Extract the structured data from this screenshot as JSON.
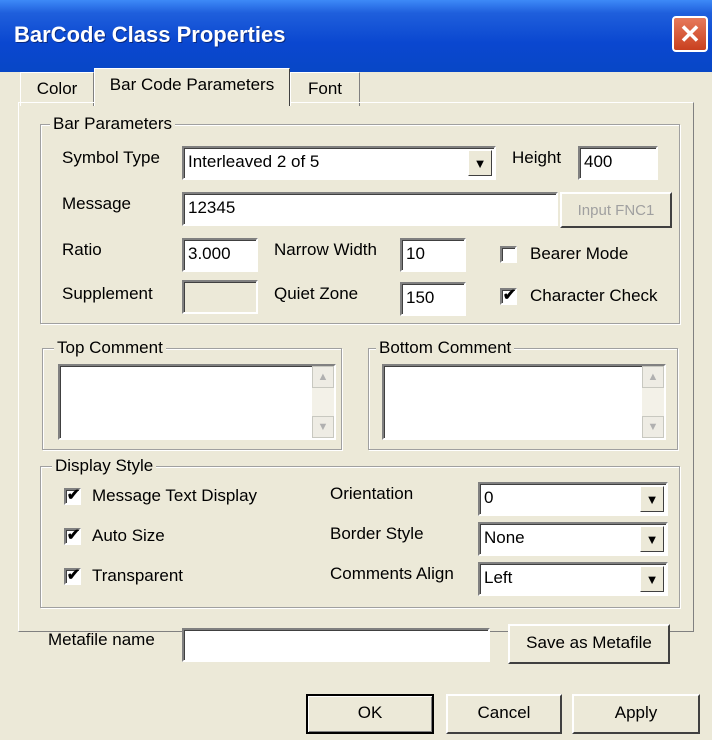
{
  "window": {
    "title": "BarCode Class Properties"
  },
  "tabs": [
    "Color",
    "Bar Code Parameters",
    "Font"
  ],
  "bar_parameters": {
    "legend": "Bar Parameters",
    "symbol_type_label": "Symbol Type",
    "symbol_type_value": "Interleaved 2 of 5",
    "height_label": "Height",
    "height_value": "400",
    "message_label": "Message",
    "message_value": "12345",
    "input_fnc1_label": "Input FNC1",
    "ratio_label": "Ratio",
    "ratio_value": "3.000",
    "narrow_width_label": "Narrow Width",
    "narrow_width_value": "10",
    "bearer_mode_label": "Bearer  Mode",
    "bearer_mode_checked": false,
    "supplement_label": "Supplement",
    "supplement_value": "",
    "quiet_zone_label": "Quiet Zone",
    "quiet_zone_value": "150",
    "character_check_label": "Character Check",
    "character_check_checked": true
  },
  "top_comment": {
    "legend": "Top Comment",
    "value": ""
  },
  "bottom_comment": {
    "legend": "Bottom Comment",
    "value": ""
  },
  "display_style": {
    "legend": "Display Style",
    "message_text_display_label": "Message Text Display",
    "message_text_display_checked": true,
    "auto_size_label": "Auto Size",
    "auto_size_checked": true,
    "transparent_label": "Transparent",
    "transparent_checked": true,
    "orientation_label": "Orientation",
    "orientation_value": "0",
    "border_style_label": "Border Style",
    "border_style_value": "None",
    "comments_align_label": "Comments Align",
    "comments_align_value": "Left"
  },
  "metafile": {
    "label": "Metafile name",
    "value": "",
    "save_label": "Save as Metafile"
  },
  "buttons": {
    "ok": "OK",
    "cancel": "Cancel",
    "apply": "Apply"
  },
  "icons": {
    "close": "close-icon",
    "dropdown": "chevron-down-icon",
    "check": "checkmark-icon",
    "scroll_up": "scroll-up-arrow-icon",
    "scroll_down": "scroll-down-arrow-icon"
  },
  "colors": {
    "titlebar": "#0a47d0",
    "dialog_bg": "#ece9d8",
    "close_button": "#c9401f"
  },
  "glyphs": {
    "close": "✕",
    "down": "▼",
    "check": "✔",
    "up_small": "▲",
    "down_small": "▼"
  }
}
